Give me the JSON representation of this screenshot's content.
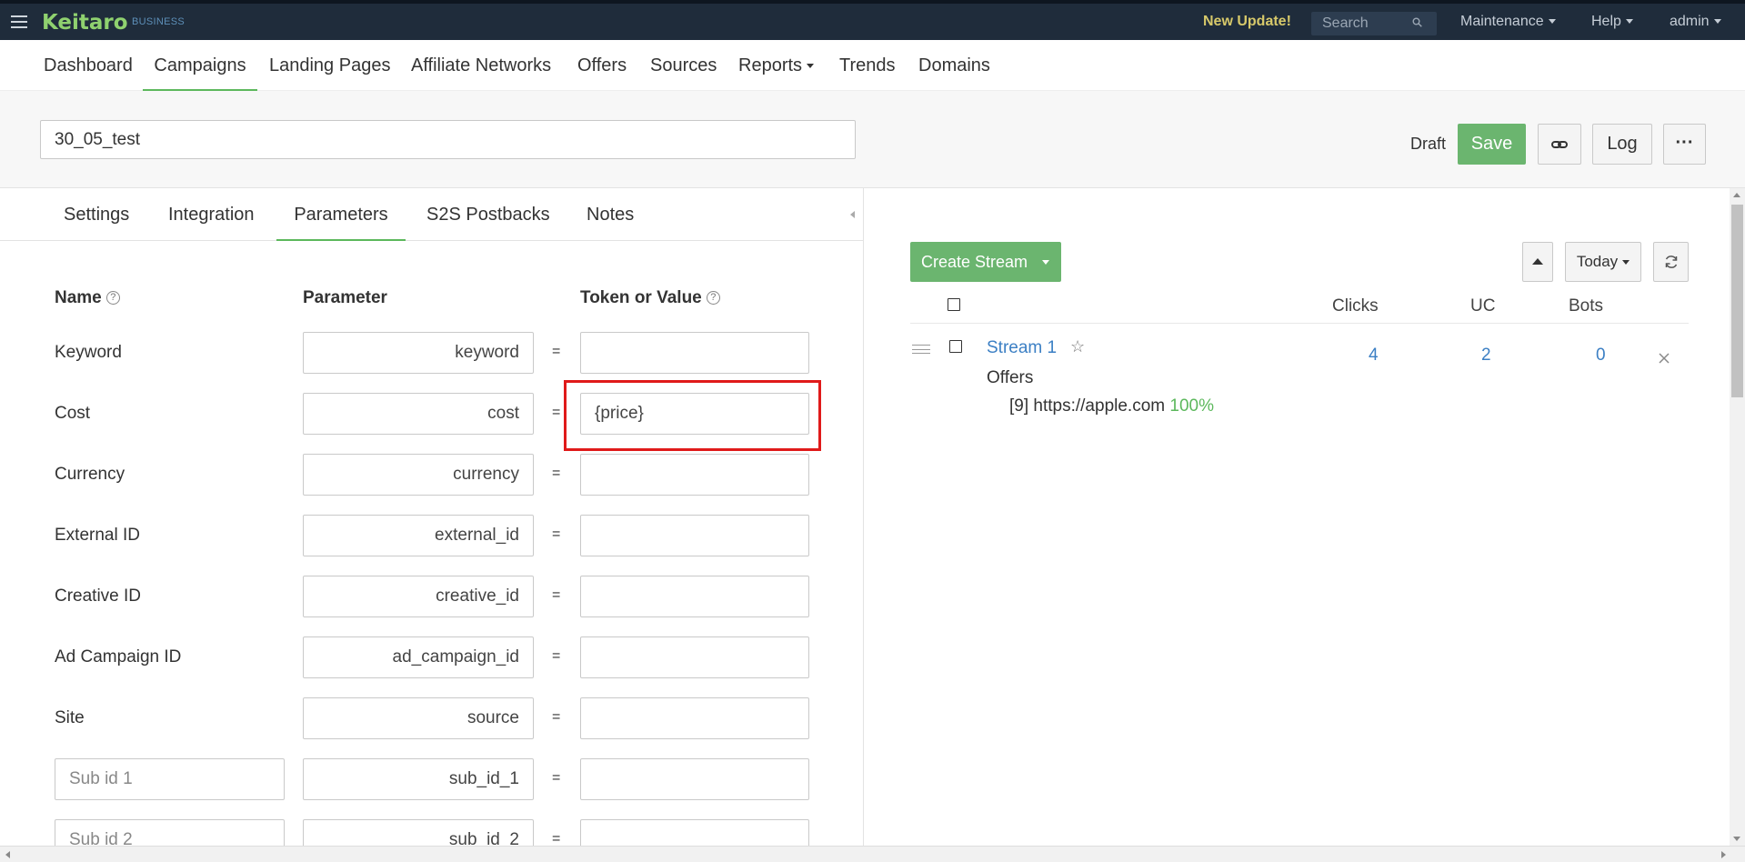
{
  "app": {
    "logo": "Keitaro",
    "edition": "BUSINESS",
    "new_update": "New Update!",
    "search_placeholder": "Search",
    "menus": [
      "Maintenance",
      "Help",
      "admin"
    ]
  },
  "nav": {
    "items": [
      "Dashboard",
      "Campaigns",
      "Landing Pages",
      "Affiliate Networks",
      "Offers",
      "Sources",
      "Reports",
      "Trends",
      "Domains"
    ],
    "active": "Campaigns"
  },
  "campaign": {
    "name": "30_05_test",
    "status": "Draft",
    "save_label": "Save",
    "log_label": "Log",
    "more_label": "···"
  },
  "tabs": {
    "items": [
      "Settings",
      "Integration",
      "Parameters",
      "S2S Postbacks",
      "Notes"
    ],
    "active": "Parameters"
  },
  "params": {
    "col_name": "Name",
    "col_parameter": "Parameter",
    "col_token": "Token or Value",
    "equals": "=",
    "rows": [
      {
        "name": "Keyword",
        "parameter": "keyword",
        "token": ""
      },
      {
        "name": "Cost",
        "parameter": "cost",
        "token": "{price}"
      },
      {
        "name": "Currency",
        "parameter": "currency",
        "token": ""
      },
      {
        "name": "External ID",
        "parameter": "external_id",
        "token": ""
      },
      {
        "name": "Creative ID",
        "parameter": "creative_id",
        "token": ""
      },
      {
        "name": "Ad Campaign ID",
        "parameter": "ad_campaign_id",
        "token": ""
      },
      {
        "name": "Site",
        "parameter": "source",
        "token": ""
      },
      {
        "name_placeholder": "Sub id 1",
        "parameter": "sub_id_1",
        "token": ""
      },
      {
        "name_placeholder": "Sub id 2",
        "parameter": "sub_id_2",
        "token": ""
      }
    ]
  },
  "streams": {
    "create_label": "Create Stream",
    "period_label": "Today",
    "columns": {
      "clicks": "Clicks",
      "uc": "UC",
      "bots": "Bots"
    },
    "items": [
      {
        "name": "Stream 1",
        "section": "Offers",
        "offer": "[9] https://apple.com",
        "share": "100%",
        "clicks": "4",
        "uc": "2",
        "bots": "0"
      }
    ]
  },
  "colors": {
    "topbar": "#1f2c3b",
    "accent_green": "#5cb85c",
    "link_blue": "#3b7fc4",
    "highlight_red": "#e01a1a"
  }
}
